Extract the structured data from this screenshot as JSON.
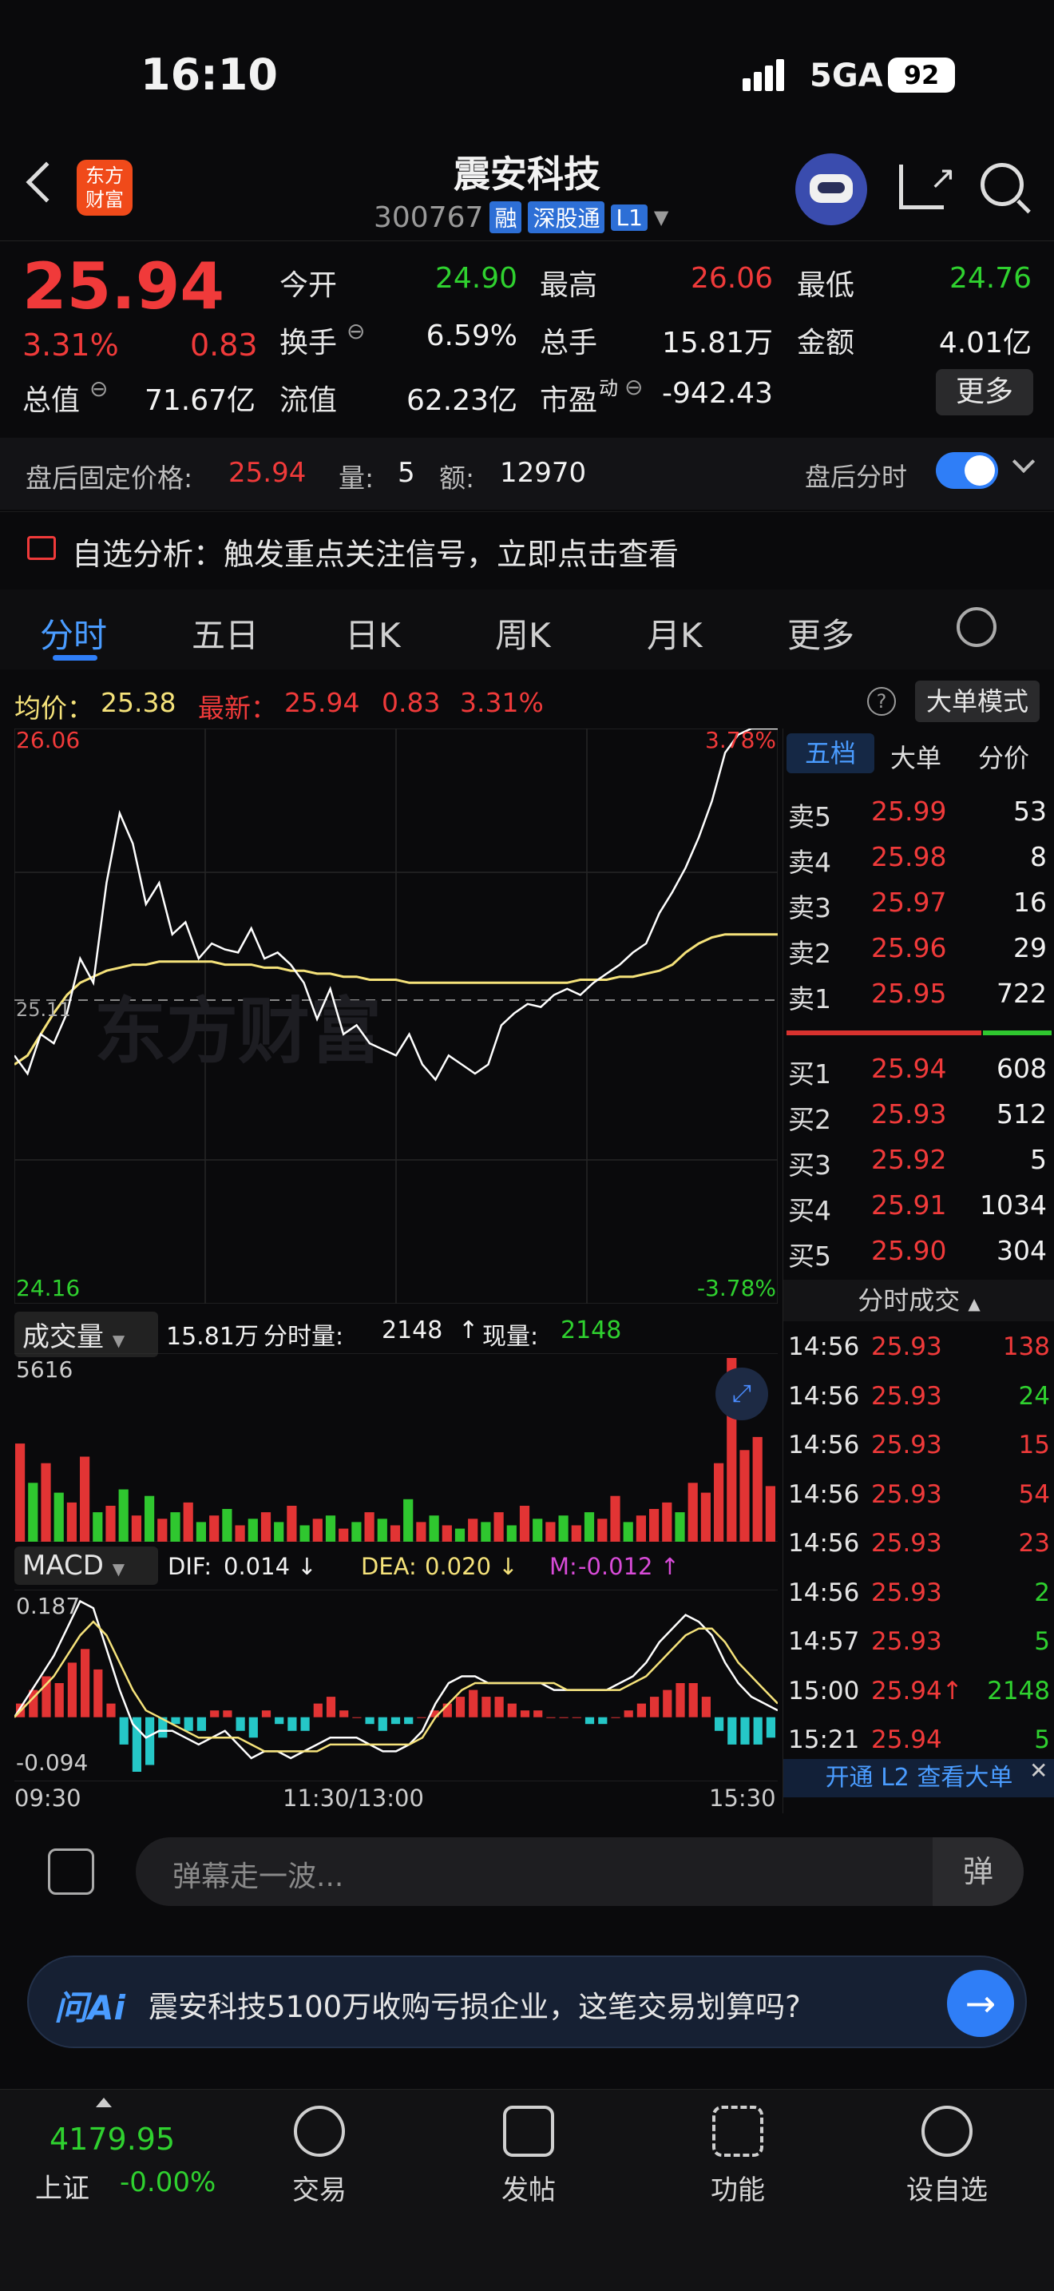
{
  "status": {
    "time": "16:10",
    "network": "5GA",
    "battery": "92"
  },
  "header": {
    "logo_line1": "东方",
    "logo_line2": "财富",
    "name": "震安科技",
    "code": "300767",
    "tags": [
      "融",
      "深股通",
      "L1"
    ]
  },
  "quote": {
    "price": "25.94",
    "pct": "3.31%",
    "change": "0.83",
    "open_label": "今开",
    "open": "24.90",
    "high_label": "最高",
    "high": "26.06",
    "low_label": "最低",
    "low": "24.76",
    "turnover_label": "换手",
    "turnover": "6.59%",
    "vol_label": "总手",
    "vol": "15.81万",
    "amount_label": "金额",
    "amount": "4.01亿",
    "mcap_label": "总值",
    "mcap": "71.67亿",
    "float_label": "流值",
    "float": "62.23亿",
    "pe_label": "市盈",
    "pe_sup": "动",
    "pe": "-942.43",
    "more": "更多"
  },
  "after_hours": {
    "label": "盘后固定价格:",
    "price": "25.94",
    "qty_label": "量:",
    "qty": "5",
    "amt_label": "额:",
    "amt": "12970",
    "toggle_label": "盘后分时",
    "toggle_on": true
  },
  "alert": {
    "text": "自选分析：触发重点关注信号，立即点击查看"
  },
  "tabs": [
    "分时",
    "五日",
    "日K",
    "周K",
    "月K",
    "更多"
  ],
  "active_tab": "分时",
  "pricebar": {
    "avg_label": "均价：",
    "avg": "25.38",
    "latest_label": "最新：",
    "latest": "25.94",
    "chg": "0.83",
    "pct": "3.31%",
    "mode": "大单模式"
  },
  "chart_data": {
    "type": "line",
    "title": "",
    "y_max_label": "26.06",
    "y_min_label": "24.16",
    "pct_max": "3.78%",
    "pct_min": "-3.78%",
    "ref_label": "25.11",
    "ylim": [
      24.16,
      26.06
    ],
    "x_labels": [
      "09:30",
      "11:30/13:00",
      "15:30"
    ],
    "series": [
      {
        "name": "",
        "color": "#ffffff",
        "values": [
          24.98,
          24.92,
          25.05,
          25.02,
          25.12,
          25.3,
          25.22,
          25.55,
          25.78,
          25.68,
          25.48,
          25.55,
          25.38,
          25.42,
          25.3,
          25.35,
          25.33,
          25.32,
          25.4,
          25.3,
          25.32,
          25.28,
          25.22,
          25.1,
          25.2,
          25.05,
          25.08,
          25.02,
          25.0,
          24.98,
          25.05,
          24.95,
          24.9,
          24.98,
          24.95,
          24.92,
          24.95,
          25.08,
          25.12,
          25.15,
          25.14,
          25.18,
          25.2,
          25.18,
          25.22,
          25.25,
          25.28,
          25.32,
          25.35,
          25.45,
          25.52,
          25.6,
          25.7,
          25.82,
          25.98,
          26.04,
          26.06,
          26.06,
          26.06
        ]
      },
      {
        "name": "",
        "color": "#f5e27a",
        "values": [
          24.95,
          24.98,
          25.05,
          25.12,
          25.18,
          25.22,
          25.24,
          25.26,
          25.27,
          25.28,
          25.28,
          25.29,
          25.29,
          25.29,
          25.29,
          25.29,
          25.28,
          25.28,
          25.28,
          25.27,
          25.27,
          25.26,
          25.26,
          25.25,
          25.25,
          25.24,
          25.24,
          25.23,
          25.23,
          25.23,
          25.22,
          25.22,
          25.22,
          25.22,
          25.22,
          25.22,
          25.22,
          25.22,
          25.22,
          25.22,
          25.22,
          25.22,
          25.22,
          25.23,
          25.23,
          25.23,
          25.24,
          25.24,
          25.25,
          25.26,
          25.28,
          25.32,
          25.35,
          25.37,
          25.38,
          25.38,
          25.38,
          25.38,
          25.38
        ]
      }
    ],
    "volume": {
      "title": "成交量",
      "total": "15.81万",
      "fs_label": "分时量:",
      "fs": "2148",
      "cur_label": "现量:",
      "cur": "2148",
      "max_label": "5616",
      "values": [
        3000,
        1800,
        2400,
        1500,
        1200,
        2600,
        900,
        1100,
        1600,
        800,
        1400,
        700,
        900,
        1200,
        600,
        800,
        1000,
        500,
        700,
        900,
        600,
        1100,
        500,
        700,
        800,
        400,
        600,
        900,
        700,
        500,
        1300,
        600,
        800,
        500,
        400,
        700,
        600,
        900,
        500,
        1100,
        700,
        600,
        800,
        500,
        900,
        700,
        1400,
        600,
        800,
        1000,
        1200,
        900,
        1800,
        1500,
        2400,
        5616,
        2800,
        3200,
        1700
      ],
      "colors": [
        "r",
        "g",
        "r",
        "g",
        "r",
        "r",
        "g",
        "r",
        "g",
        "r",
        "g",
        "r",
        "g",
        "r",
        "g",
        "r",
        "g",
        "r",
        "g",
        "r",
        "g",
        "r",
        "g",
        "r",
        "g",
        "r",
        "g",
        "r",
        "g",
        "r",
        "g",
        "r",
        "g",
        "r",
        "g",
        "r",
        "g",
        "r",
        "g",
        "r",
        "g",
        "r",
        "g",
        "r",
        "g",
        "r",
        "r",
        "g",
        "r",
        "r",
        "r",
        "g",
        "r",
        "r",
        "r",
        "r",
        "r",
        "r",
        "r"
      ]
    },
    "macd": {
      "title": "MACD",
      "dif_label": "DIF:",
      "dif": "0.014 ↓",
      "dea_label": "DEA:",
      "dea": "0.020 ↓",
      "m_label": "M:",
      "m": "-0.012 ↑",
      "ymax_label": "0.187",
      "ymin_label": "-0.094",
      "hist": [
        0.02,
        0.04,
        0.06,
        0.05,
        0.08,
        0.1,
        0.07,
        0.02,
        -0.04,
        -0.08,
        -0.07,
        -0.03,
        -0.01,
        -0.02,
        -0.02,
        0.01,
        0.01,
        -0.02,
        -0.03,
        0.01,
        -0.01,
        -0.02,
        -0.02,
        0.02,
        0.03,
        0.01,
        0.0,
        -0.01,
        -0.02,
        -0.01,
        -0.01,
        0.0,
        0.01,
        0.02,
        0.03,
        0.04,
        0.03,
        0.03,
        0.02,
        0.01,
        0.01,
        0.0,
        0.0,
        0.0,
        -0.01,
        -0.01,
        0.0,
        0.01,
        0.02,
        0.03,
        0.04,
        0.05,
        0.05,
        0.03,
        -0.02,
        -0.04,
        -0.04,
        -0.04,
        -0.03
      ],
      "dif_line": [
        0.0,
        0.03,
        0.06,
        0.09,
        0.13,
        0.17,
        0.16,
        0.1,
        0.04,
        -0.01,
        -0.03,
        -0.02,
        -0.02,
        -0.03,
        -0.04,
        -0.03,
        -0.02,
        -0.04,
        -0.06,
        -0.05,
        -0.05,
        -0.06,
        -0.05,
        -0.04,
        -0.03,
        -0.03,
        -0.03,
        -0.04,
        -0.05,
        -0.05,
        -0.04,
        -0.02,
        0.02,
        0.05,
        0.06,
        0.06,
        0.05,
        0.05,
        0.05,
        0.05,
        0.05,
        0.04,
        0.04,
        0.04,
        0.04,
        0.04,
        0.05,
        0.06,
        0.08,
        0.11,
        0.13,
        0.15,
        0.14,
        0.12,
        0.08,
        0.05,
        0.03,
        0.02,
        0.01
      ],
      "dea_line": [
        0.0,
        0.02,
        0.04,
        0.06,
        0.09,
        0.12,
        0.14,
        0.12,
        0.08,
        0.04,
        0.01,
        0.0,
        -0.01,
        -0.02,
        -0.03,
        -0.03,
        -0.03,
        -0.03,
        -0.04,
        -0.05,
        -0.05,
        -0.05,
        -0.05,
        -0.05,
        -0.04,
        -0.04,
        -0.04,
        -0.04,
        -0.04,
        -0.04,
        -0.04,
        -0.03,
        0.0,
        0.02,
        0.04,
        0.05,
        0.05,
        0.05,
        0.05,
        0.05,
        0.05,
        0.05,
        0.04,
        0.04,
        0.04,
        0.04,
        0.04,
        0.05,
        0.06,
        0.08,
        0.1,
        0.12,
        0.13,
        0.13,
        0.11,
        0.08,
        0.06,
        0.04,
        0.02
      ]
    }
  },
  "orderbook": {
    "tabs": [
      "五档",
      "大单",
      "分价"
    ],
    "asks": [
      {
        "label": "卖5",
        "price": "25.99",
        "vol": "53"
      },
      {
        "label": "卖4",
        "price": "25.98",
        "vol": "8"
      },
      {
        "label": "卖3",
        "price": "25.97",
        "vol": "16"
      },
      {
        "label": "卖2",
        "price": "25.96",
        "vol": "29"
      },
      {
        "label": "卖1",
        "price": "25.95",
        "vol": "722"
      }
    ],
    "bids": [
      {
        "label": "买1",
        "price": "25.94",
        "vol": "608"
      },
      {
        "label": "买2",
        "price": "25.93",
        "vol": "512"
      },
      {
        "label": "买3",
        "price": "25.92",
        "vol": "5"
      },
      {
        "label": "买4",
        "price": "25.91",
        "vol": "1034"
      },
      {
        "label": "买5",
        "price": "25.90",
        "vol": "304"
      }
    ],
    "ticks_title": "分时成交",
    "ticks": [
      {
        "t": "14:56",
        "p": "25.93",
        "v": "138",
        "c": "red"
      },
      {
        "t": "14:56",
        "p": "25.93",
        "v": "24",
        "c": "green"
      },
      {
        "t": "14:56",
        "p": "25.93",
        "v": "15",
        "c": "red"
      },
      {
        "t": "14:56",
        "p": "25.93",
        "v": "54",
        "c": "red"
      },
      {
        "t": "14:56",
        "p": "25.93",
        "v": "23",
        "c": "red"
      },
      {
        "t": "14:56",
        "p": "25.93",
        "v": "2",
        "c": "green"
      },
      {
        "t": "14:57",
        "p": "25.93",
        "v": "5",
        "c": "green"
      },
      {
        "t": "15:00",
        "p": "25.94↑",
        "v": "2148",
        "c": "green"
      },
      {
        "t": "15:21",
        "p": "25.94",
        "v": "5",
        "c": "green"
      }
    ],
    "l2": "开通 L2 查看大单"
  },
  "danmu": {
    "placeholder": "弹幕走一波...",
    "btn": "弹"
  },
  "ai": {
    "brand": "问Ai",
    "text": "震安科技5100万收购亏损企业，这笔交易划算吗?"
  },
  "tabbar": {
    "index_value": "4179.95",
    "index_name": "上证",
    "index_pct": "-0.00%",
    "items": [
      "交易",
      "发帖",
      "功能",
      "设自选"
    ]
  }
}
